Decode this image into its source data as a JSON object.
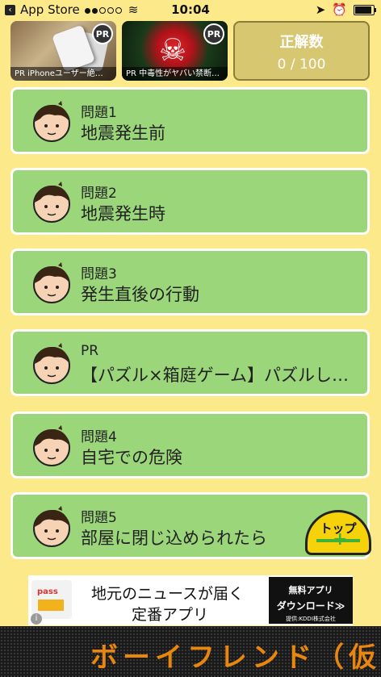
{
  "status_bar": {
    "back_app": "App Store",
    "time": "10:04"
  },
  "top_tiles": [
    {
      "pr": "PR",
      "caption": "PR iPhoneユーザー絶…"
    },
    {
      "pr": "PR",
      "caption": "PR 中毒性がヤバい禁断…"
    }
  ],
  "score": {
    "label": "正解数",
    "value": "0 / 100"
  },
  "questions": [
    {
      "num": "問題1",
      "title": "地震発生前"
    },
    {
      "num": "問題2",
      "title": "地震発生時"
    },
    {
      "num": "問題3",
      "title": "発生直後の行動"
    },
    {
      "num": "PR",
      "title": "【パズル×箱庭ゲーム】パズルし…"
    },
    {
      "num": "問題4",
      "title": "自宅での危険"
    },
    {
      "num": "問題5",
      "title": "部屋に閉じ込められたら"
    }
  ],
  "top_button": {
    "label": "トップ"
  },
  "banner": {
    "logo_text": "pass",
    "line1": "地元のニュースが届く",
    "line2": "定番アプリ",
    "cta1": "無料アプリ",
    "cta2": "ダウンロード≫",
    "provider": "提供:KDDI株式会社"
  },
  "ticker": {
    "text": "ボーイフレンド（仮）き"
  },
  "colors": {
    "background": "#fbe98a",
    "card": "#9bd67a",
    "score_bg": "#d7c771",
    "ticker_text": "#e8860e"
  }
}
